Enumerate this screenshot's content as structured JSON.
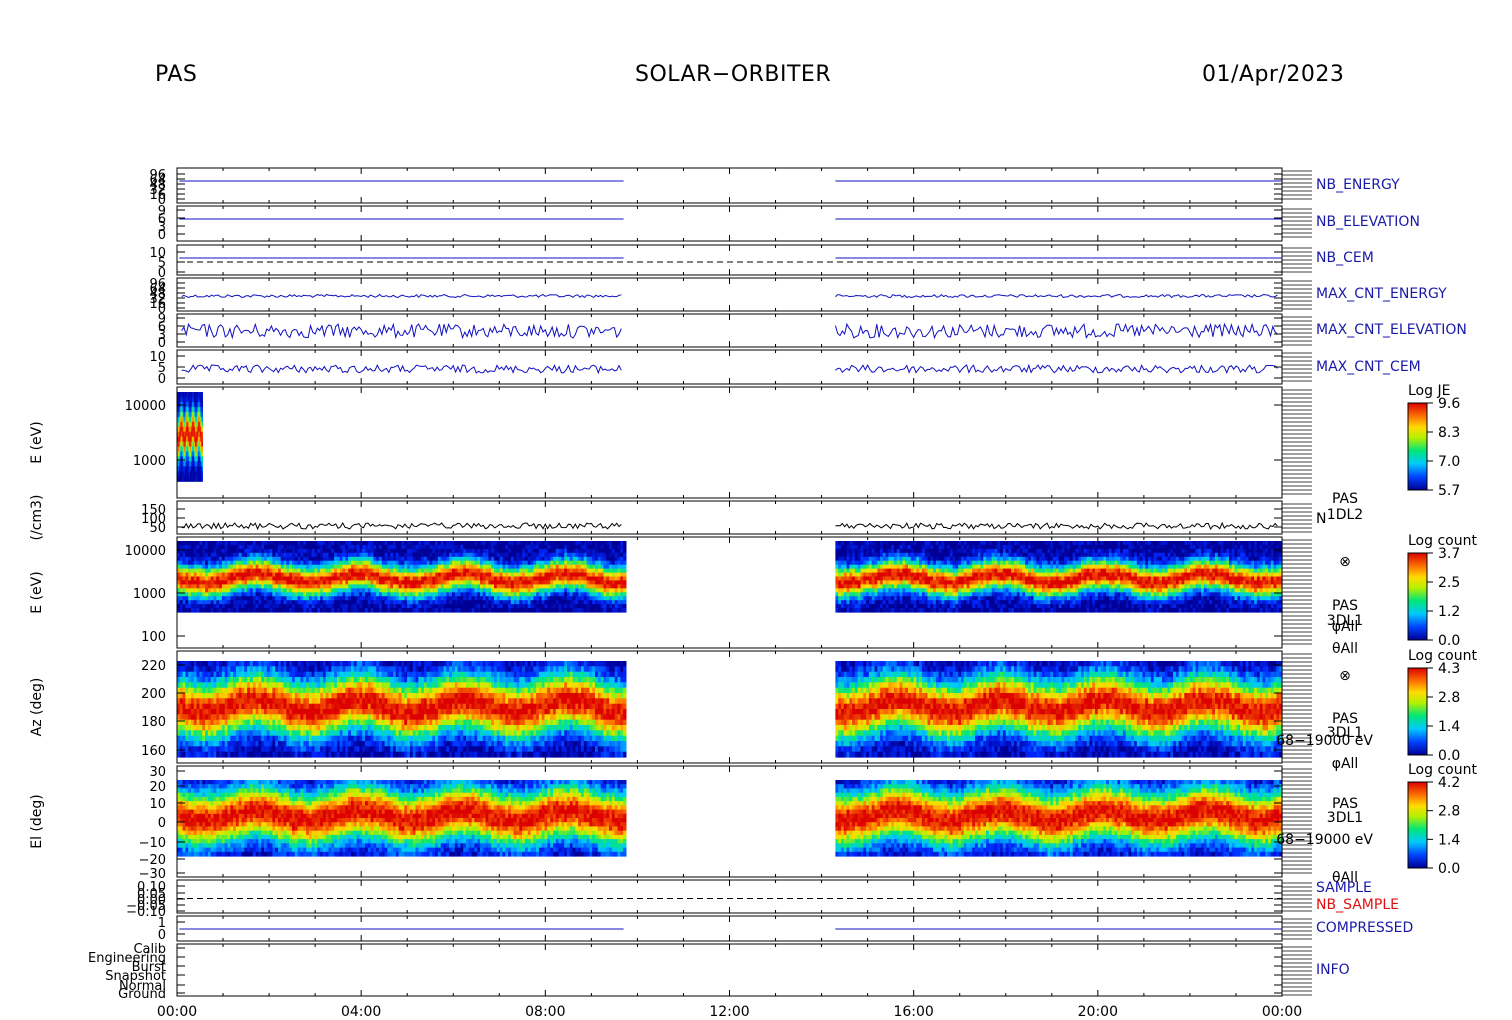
{
  "header": {
    "left": "PAS",
    "center": "SOLAR−ORBITER",
    "right": "01/Apr/2023"
  },
  "colors": {
    "trace": "#1010c0",
    "label_blue": "#1a1aa8",
    "label_red": "#e01010",
    "axis": "#000000"
  },
  "chart_data": {
    "type": "heatmap",
    "x_ticks": [
      "00:00",
      "04:00",
      "08:00",
      "12:00",
      "16:00",
      "20:00",
      "00:00"
    ],
    "x_range_hours": [
      0,
      24
    ],
    "data_gap_hours": [
      9.7,
      14.3
    ],
    "panels": [
      {
        "id": "nb-energy",
        "ylabel": "",
        "right_label": "NB_ENERGY",
        "tick_labels": [
          "96",
          "64",
          "48",
          "32",
          "16",
          "0"
        ]
      },
      {
        "id": "nb-elevation",
        "ylabel": "",
        "right_label": "NB_ELEVATION",
        "tick_labels": [
          "9",
          "6",
          "3",
          "0"
        ]
      },
      {
        "id": "nb-cem",
        "ylabel": "",
        "right_label": "NB_CEM",
        "tick_labels": [
          "10",
          "5",
          "0"
        ]
      },
      {
        "id": "max-cnt-energy",
        "ylabel": "",
        "right_label": "MAX_CNT_ENERGY",
        "tick_labels": [
          "96",
          "64",
          "48",
          "32",
          "16",
          "0"
        ]
      },
      {
        "id": "max-cnt-elevation",
        "ylabel": "",
        "right_label": "MAX_CNT_ELEVATION",
        "tick_labels": [
          "9",
          "6",
          "3",
          "0"
        ]
      },
      {
        "id": "max-cnt-cem",
        "ylabel": "",
        "right_label": "MAX_CNT_CEM",
        "tick_labels": [
          "10",
          "5",
          "0"
        ]
      },
      {
        "id": "energy-spectrogram-l2",
        "ylabel": "E (eV)",
        "tick_labels": [
          "10000",
          "1000"
        ],
        "colorbar": {
          "title": "Log JE",
          "ticks": [
            "9.6",
            "8.3",
            "7.0",
            "5.7"
          ]
        }
      },
      {
        "id": "density",
        "ylabel": "(/cm3)",
        "tick_labels": [
          "150",
          "100",
          "50"
        ],
        "right_label": "N",
        "side_labels": [
          "PAS",
          "1DL2"
        ]
      },
      {
        "id": "energy-spectrogram-l1",
        "ylabel": "E (eV)",
        "tick_labels": [
          "10000",
          "1000",
          "100"
        ],
        "side_labels": [
          "⊗",
          "PAS",
          "3DL1",
          "φAll",
          "θAll"
        ],
        "colorbar": {
          "title": "Log count",
          "ticks": [
            "3.7",
            "2.5",
            "1.2",
            "0.0"
          ]
        }
      },
      {
        "id": "azimuth-spectrogram",
        "ylabel": "Az (deg)",
        "tick_labels": [
          "220",
          "200",
          "180",
          "160"
        ],
        "side_labels": [
          "⊗",
          "PAS",
          "3DL1",
          "68−19000 eV",
          "φAll"
        ],
        "colorbar": {
          "title": "Log count",
          "ticks": [
            "4.3",
            "2.8",
            "1.4",
            "0.0"
          ]
        }
      },
      {
        "id": "elevation-spectrogram",
        "ylabel": "El (deg)",
        "tick_labels": [
          "30",
          "20",
          "10",
          "0",
          "−10",
          "−20",
          "−30"
        ],
        "side_labels": [
          "PAS",
          "3DL1",
          "68−19000 eV",
          "θAll"
        ],
        "colorbar": {
          "title": "Log count",
          "ticks": [
            "4.2",
            "2.8",
            "1.4",
            "0.0"
          ]
        }
      },
      {
        "id": "sample",
        "ylabel": "",
        "tick_labels": [
          "0.10",
          "0.05",
          "0.00",
          "−0.05",
          "−0.10"
        ],
        "right_labels": [
          "SAMPLE",
          "NB_SAMPLE"
        ]
      },
      {
        "id": "compressed",
        "ylabel": "",
        "tick_labels": [
          "1",
          "0"
        ],
        "right_label": "COMPRESSED"
      },
      {
        "id": "info",
        "ylabel": "",
        "tick_labels": [
          "Calib",
          "Engineering",
          "Burst",
          "Snapshot",
          "Normal",
          "Ground"
        ],
        "right_label": "INFO"
      }
    ]
  }
}
